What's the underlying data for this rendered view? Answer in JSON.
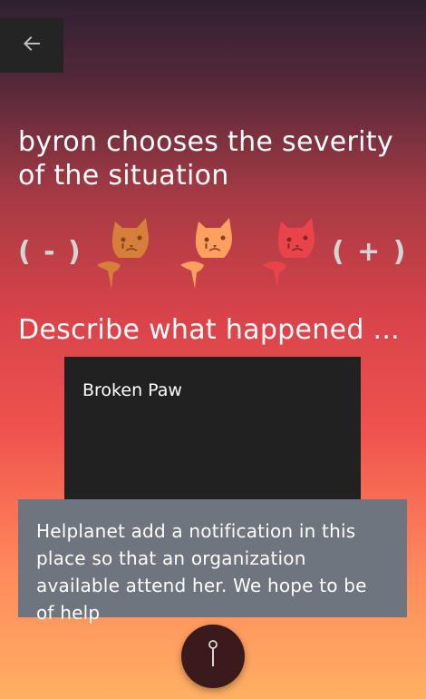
{
  "header": {
    "back_icon": "arrow-left-icon"
  },
  "title": "byron chooses the severity of the situation",
  "severity": {
    "minus_label": "( - )",
    "plus_label": "( + )",
    "levels": [
      {
        "icon": "injured-cat-icon",
        "color": "#d67f3b"
      },
      {
        "icon": "injured-cat-icon",
        "color": "#ffa060"
      },
      {
        "icon": "injured-cat-icon",
        "color": "#e8444a"
      }
    ]
  },
  "describe": {
    "heading": "Describe what happened ...",
    "value": "Broken Paw"
  },
  "notification": {
    "text": "Helplanet add a notification in this place so that an organization available attend her. We hope to be of help"
  },
  "fab": {
    "icon": "pin-icon"
  }
}
